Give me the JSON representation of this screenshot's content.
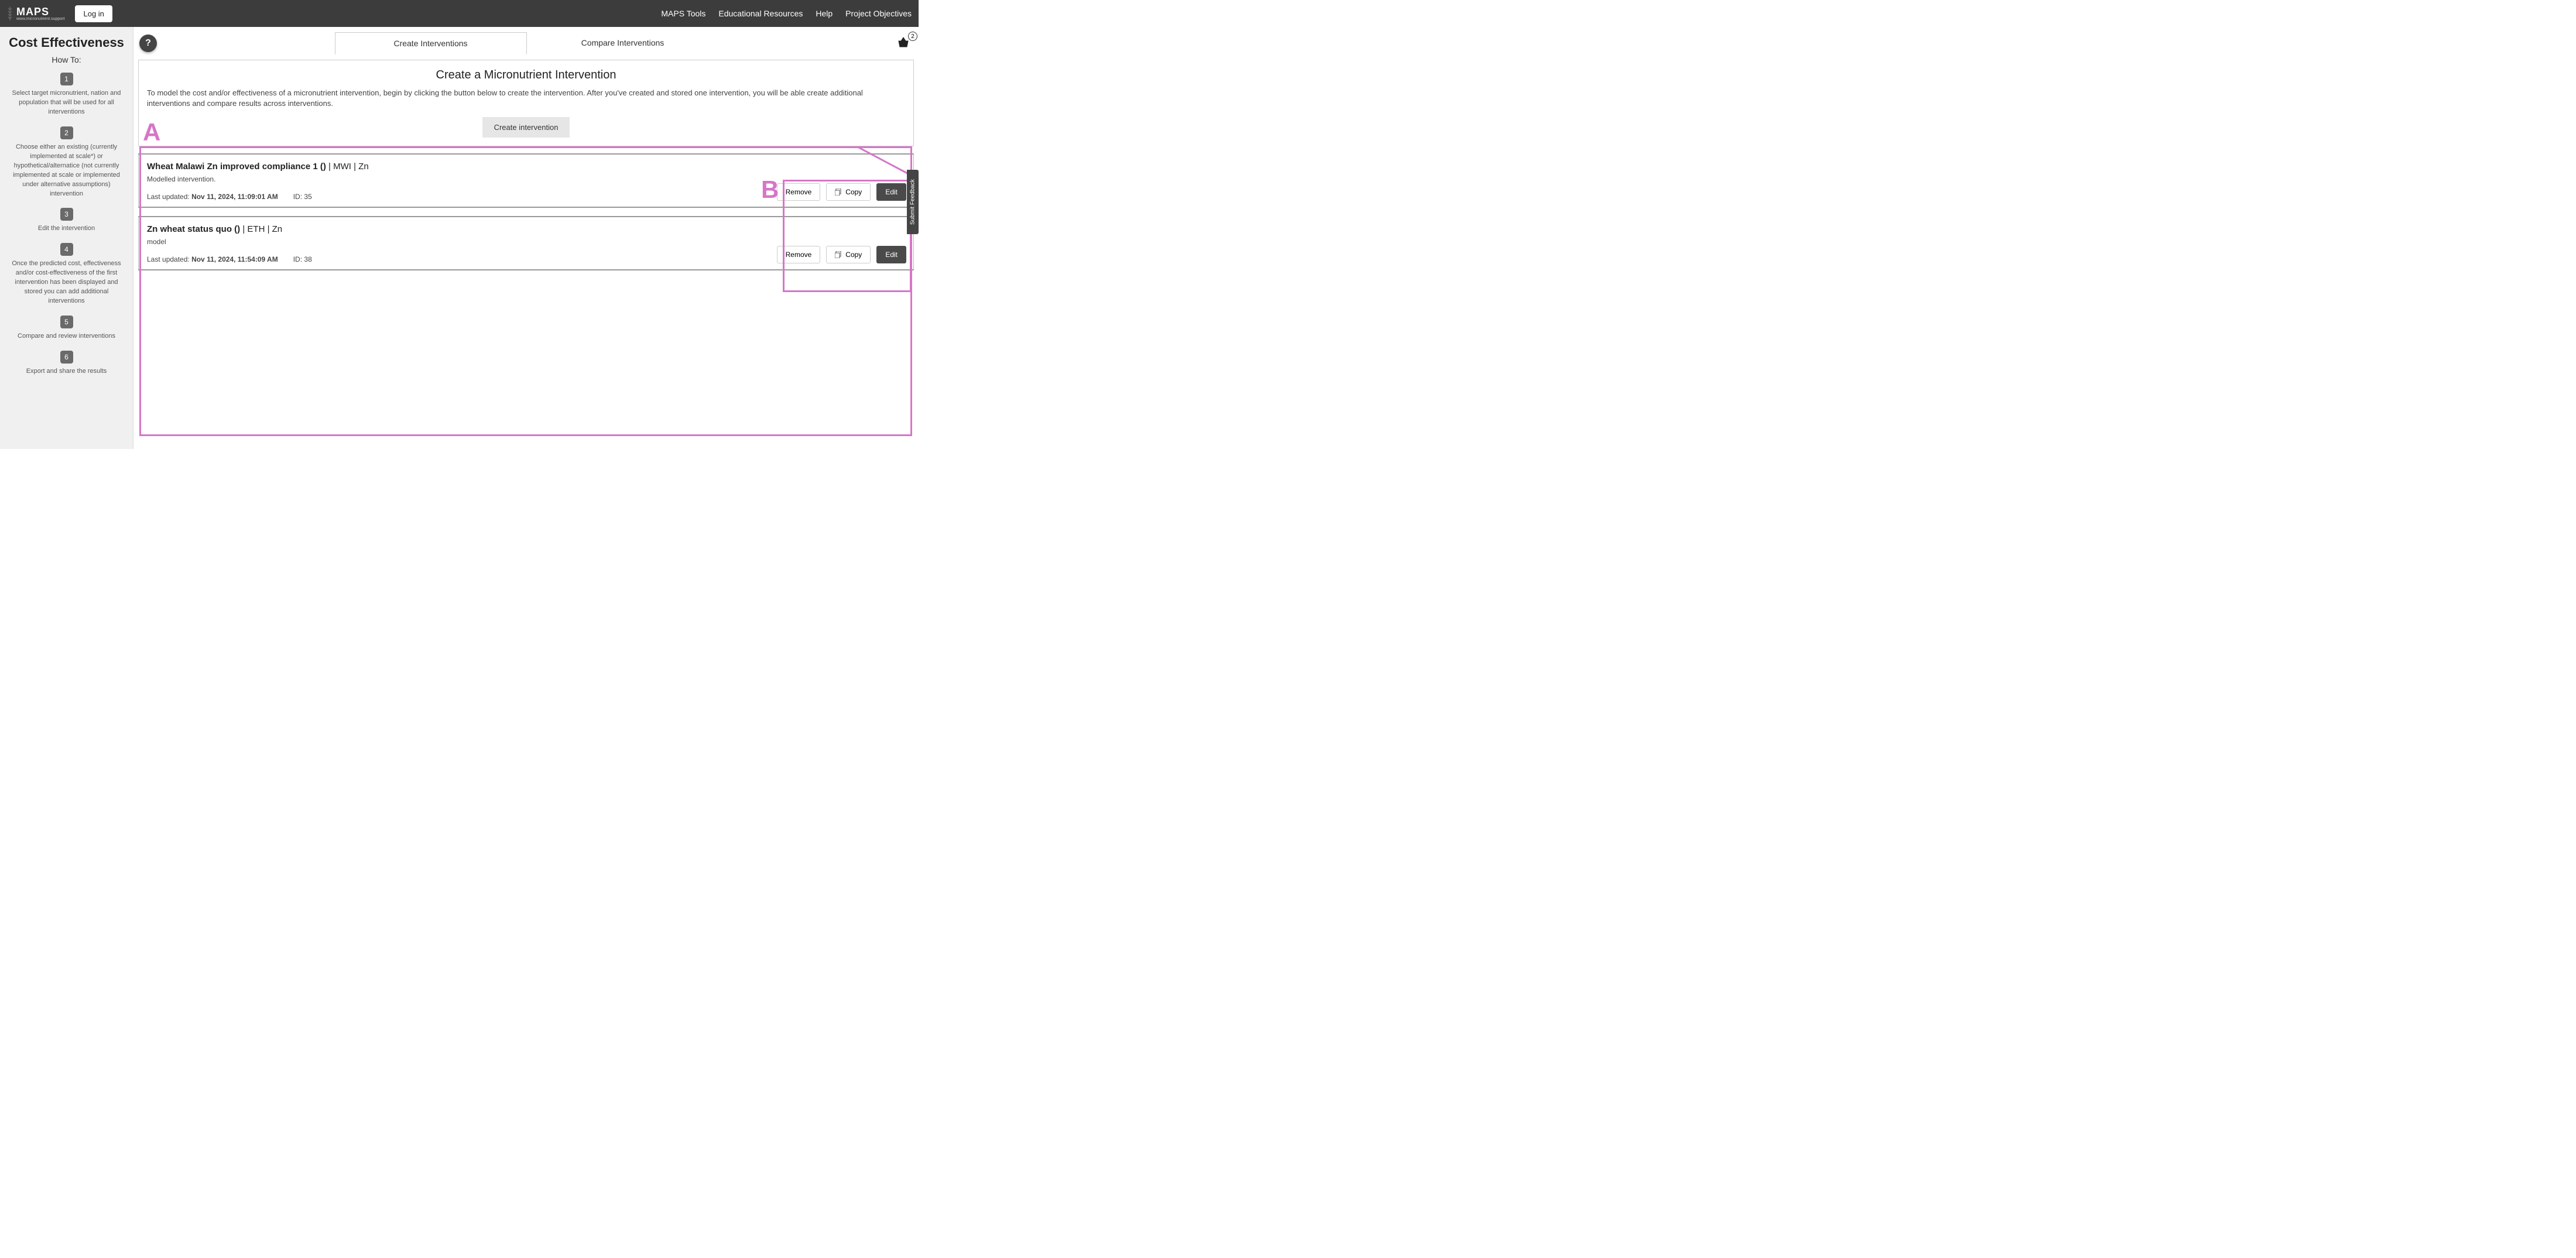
{
  "header": {
    "logo_text": "MAPS",
    "logo_sub": "www.micronutrient.support",
    "login": "Log in",
    "nav": [
      "MAPS Tools",
      "Educational Resources",
      "Help",
      "Project Objectives"
    ]
  },
  "sidebar": {
    "title": "Cost Effectiveness",
    "howto": "How To:",
    "steps": [
      {
        "n": "1",
        "text": "Select target micronutrient, nation and population that will be used for all interventions"
      },
      {
        "n": "2",
        "text": "Choose either an existing (currently implemented at scale*) or hypothetical/alternatice (not currently implemented at scale or implemented under alternative assumptions) intervention"
      },
      {
        "n": "3",
        "text": "Edit the intervention"
      },
      {
        "n": "4",
        "text": "Once the predicted cost, effectiveness and/or cost-effectiveness of the first intervention has been displayed and stored you can add additional interventions"
      },
      {
        "n": "5",
        "text": "Compare and review interventions"
      },
      {
        "n": "6",
        "text": "Export and share the results"
      }
    ]
  },
  "tabs": {
    "create": "Create Interventions",
    "compare": "Compare Interventions",
    "basket_count": "2"
  },
  "help": "?",
  "panel": {
    "title": "Create a Micronutrient Intervention",
    "desc": "To model the cost and/or effectiveness of a micronutrient intervention, begin by clicking the button below to create the intervention. After you've created and stored one intervention, you will be able create additional interventions and compare results across interventions.",
    "create_btn": "Create intervention"
  },
  "btn_labels": {
    "remove": "Remove",
    "copy": "Copy",
    "edit": "Edit"
  },
  "interventions": [
    {
      "title_bold": "Wheat Malawi Zn improved compliance 1 ()",
      "title_light": " | MWI | Zn",
      "sub": "Modelled intervention.",
      "updated_label": "Last updated: ",
      "updated": "Nov 11, 2024, 11:09:01 AM",
      "id_label": "ID: ",
      "id": "35"
    },
    {
      "title_bold": "Zn wheat status quo ()",
      "title_light": " | ETH | Zn",
      "sub": "model",
      "updated_label": "Last updated: ",
      "updated": "Nov 11, 2024, 11:54:09 AM",
      "id_label": "ID: ",
      "id": "38"
    }
  ],
  "feedback": "Submit Feedback",
  "annotations": {
    "A": "A",
    "B": "B"
  }
}
